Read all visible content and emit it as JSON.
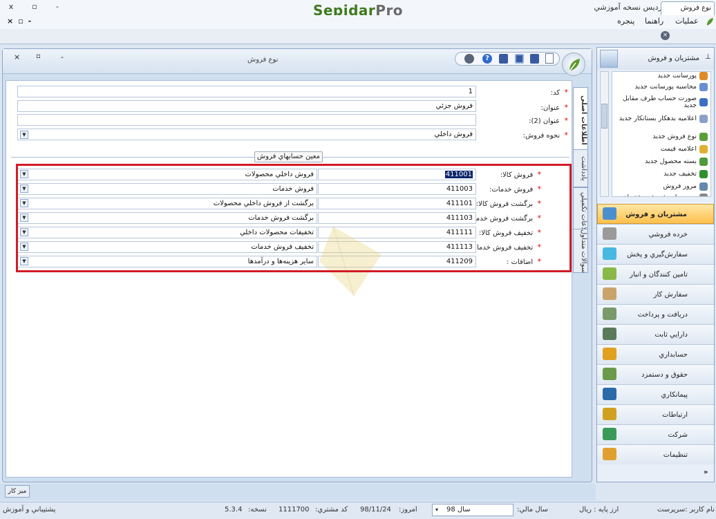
{
  "app": {
    "title": "پیوند گستر پردیس نسخه آموزشي",
    "logo_main": "Sepidar",
    "logo_suffix": "Pro"
  },
  "window_controls": {
    "close": "x",
    "restore": "▫",
    "minimize": "-"
  },
  "menu": {
    "operations": "عمليات",
    "help": "راهنما",
    "window": "پنجره"
  },
  "doc_tab": {
    "label": "نوع فروش"
  },
  "form": {
    "title": "نوع فروش",
    "vertical_tabs": [
      "اطلاعات اصلی",
      "يادداشت",
      "اطلاعات تکميلي",
      "سوالات متداول"
    ],
    "fields": {
      "code": {
        "label": "کد:",
        "value": "1"
      },
      "title": {
        "label": "عنوان:",
        "value": "فروش جزئي"
      },
      "title2": {
        "label": "عنوان (2):",
        "value": ""
      },
      "sale_method": {
        "label": "نحوه فروش:",
        "value": "فروش داخلي"
      }
    },
    "group_title": "معين حسابهاي فروش",
    "accounts": [
      {
        "label": "فروش کالا:",
        "code_pre": "",
        "code_sel": "411001",
        "name": "فروش  داخلي محصولات"
      },
      {
        "label": "فروش خدمات:",
        "code_pre": "411003",
        "code_sel": "",
        "name": "فروش خدمات"
      },
      {
        "label": "برگشت فروش کالا:",
        "code_pre": "411101",
        "code_sel": "",
        "name": "برگشت از فروش  داخلي محصولات"
      },
      {
        "label": "برگشت فروش خدمات:",
        "code_pre": "411103",
        "code_sel": "",
        "name": "برگشت فروش خدمات"
      },
      {
        "label": "تخفيف فروش کالا:",
        "code_pre": "411111",
        "code_sel": "",
        "name": "تخفيفات محصولات داخلي"
      },
      {
        "label": "تخفيف فروش خدمات:",
        "code_pre": "411113",
        "code_sel": "",
        "name": "تخفيف فروش خدمات"
      },
      {
        "label": "اضافات :",
        "code_pre": "411209",
        "code_sel": "",
        "name": "ساير هزينه‌ها و درآمدها"
      }
    ]
  },
  "side_panel": {
    "title": "مشتريان و فروش",
    "list_items": [
      {
        "label": "پورسانت جديد",
        "color": "#e08a2a"
      },
      {
        "label": "محاسبه پورسانت جديد",
        "color": "#6a8fd0"
      },
      {
        "label": "صورت حساب طرف مقابل جديد",
        "color": "#3c6fc4"
      },
      {
        "label": "اعلاميه بدهکار بستانکار جديد",
        "color": "#8aa0c8"
      },
      {
        "label": "نوع فروش جديد",
        "color": "#5a9e3a"
      },
      {
        "label": "اعلاميه قيمت",
        "color": "#e0b030"
      },
      {
        "label": "بسته محصول جديد",
        "color": "#4f9a3a"
      },
      {
        "label": "تخفيف جديد",
        "color": "#2f8f2f"
      },
      {
        "label": "مرور فروش",
        "color": "#6688aa"
      },
      {
        "label": "مرور جامع فروش مشتريان",
        "color": "#888888"
      }
    ],
    "nav": [
      {
        "label": "مشتريان و فروش",
        "color": "#4c8fd0"
      },
      {
        "label": "خرده فروشي",
        "color": "#9a9a9a"
      },
      {
        "label": "سفارش‌گيري و پخش",
        "color": "#48b8e0"
      },
      {
        "label": "تامين کنندگان و انبار",
        "color": "#8ab84a"
      },
      {
        "label": "سفارش کار",
        "color": "#c9a36a"
      },
      {
        "label": "دريافت و پرداخت",
        "color": "#7a9a6a"
      },
      {
        "label": "دارايي ثابت",
        "color": "#5a7a5a"
      },
      {
        "label": "حسابداري",
        "color": "#e0a020"
      },
      {
        "label": "حقوق و دستمزد",
        "color": "#6a9a4a"
      },
      {
        "label": "پيمانکاري",
        "color": "#2a6aa8"
      },
      {
        "label": "ارتباطات",
        "color": "#d0a020"
      },
      {
        "label": "شرکت",
        "color": "#3a9a5a"
      },
      {
        "label": "تنظيمات",
        "color": "#e0a030"
      }
    ]
  },
  "bottom_tab": {
    "label": "ميز کار"
  },
  "status": {
    "user": "نام کاربر :سرپرست",
    "base_currency": "ارز پايه : ريال",
    "fiscal_year_label": "سال مالي:",
    "fiscal_year_value": "سال 98",
    "today_label": "امروز:",
    "today_value": "98/11/24",
    "customer_code_label": "کد مشتري:",
    "customer_code_value": "1111700",
    "version_label": "نسخه:",
    "version_value": "5.3.4",
    "support": "پشتيباني و آموزش"
  }
}
